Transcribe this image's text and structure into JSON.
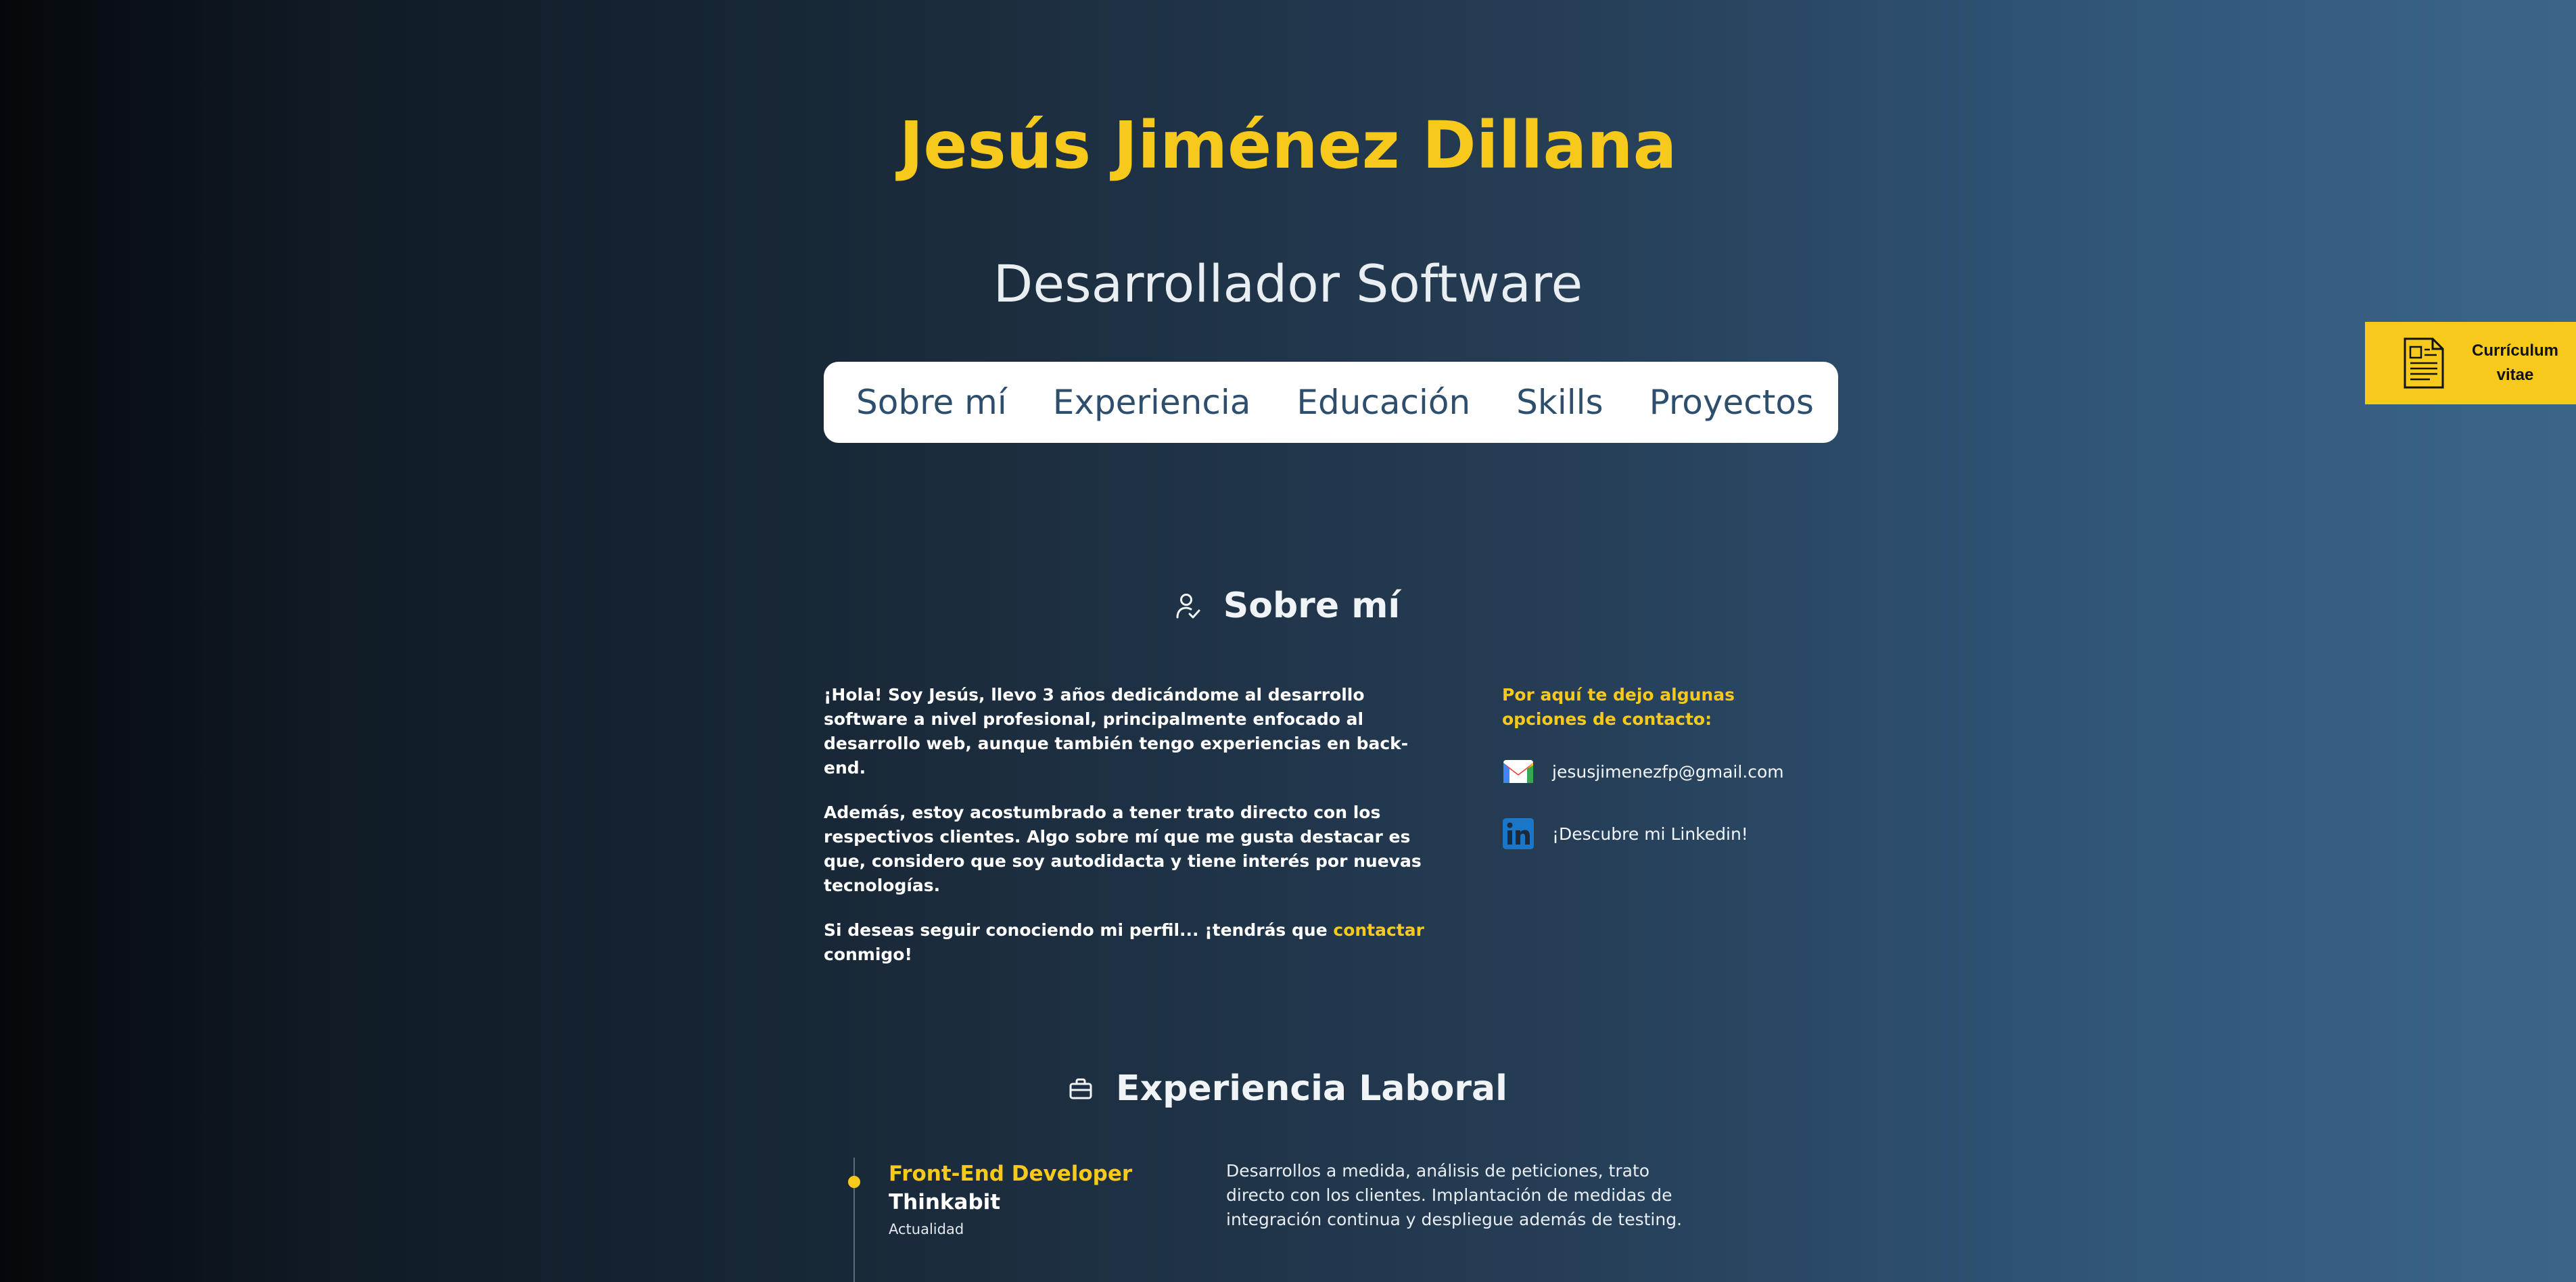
{
  "header": {
    "name": "Jesús Jiménez Dillana",
    "role": "Desarrollador Software"
  },
  "nav": {
    "items": [
      "Sobre mí",
      "Experiencia",
      "Educación",
      "Skills",
      "Proyectos"
    ]
  },
  "cv_button": {
    "label": "Currículum vitae",
    "icon": "document-icon"
  },
  "about": {
    "heading": "Sobre mí",
    "icon": "user-check-icon",
    "paragraph1": "¡Hola! Soy Jesús, llevo 3 años dedicándome al desarrollo software a nivel profesional, principalmente enfocado al desarrollo web, aunque también tengo experiencias en back-end.",
    "paragraph2": "Además, estoy acostumbrado a tener trato directo con los respectivos clientes. Algo sobre mí que me gusta destacar es que, considero que soy autodidacta y tiene interés por nuevas tecnologías.",
    "paragraph3_prefix": "Si deseas seguir conociendo mi perfil... ¡tendrás que ",
    "paragraph3_link": "contactar",
    "paragraph3_suffix": " conmigo!"
  },
  "contact": {
    "intro": "Por aquí te dejo algunas opciones de contacto:",
    "email": "jesusjimenezfp@gmail.com",
    "email_icon": "gmail-icon",
    "linkedin": "¡Descubre mi Linkedin!",
    "linkedin_icon": "linkedin-icon"
  },
  "experience": {
    "heading": "Experiencia Laboral",
    "icon": "briefcase-icon",
    "jobs": [
      {
        "role": "Front-End Developer",
        "company": "Thinkabit",
        "date": "Actualidad",
        "description": "Desarrollos a medida, análisis de peticiones, trato directo con los clientes. Implantación de medidas de integración continua y despliegue además de testing."
      }
    ]
  },
  "colors": {
    "accent": "#f6c91a",
    "nav_text": "#2d4e6c",
    "background_dark": "#05080b",
    "background_light": "#3a6589"
  }
}
